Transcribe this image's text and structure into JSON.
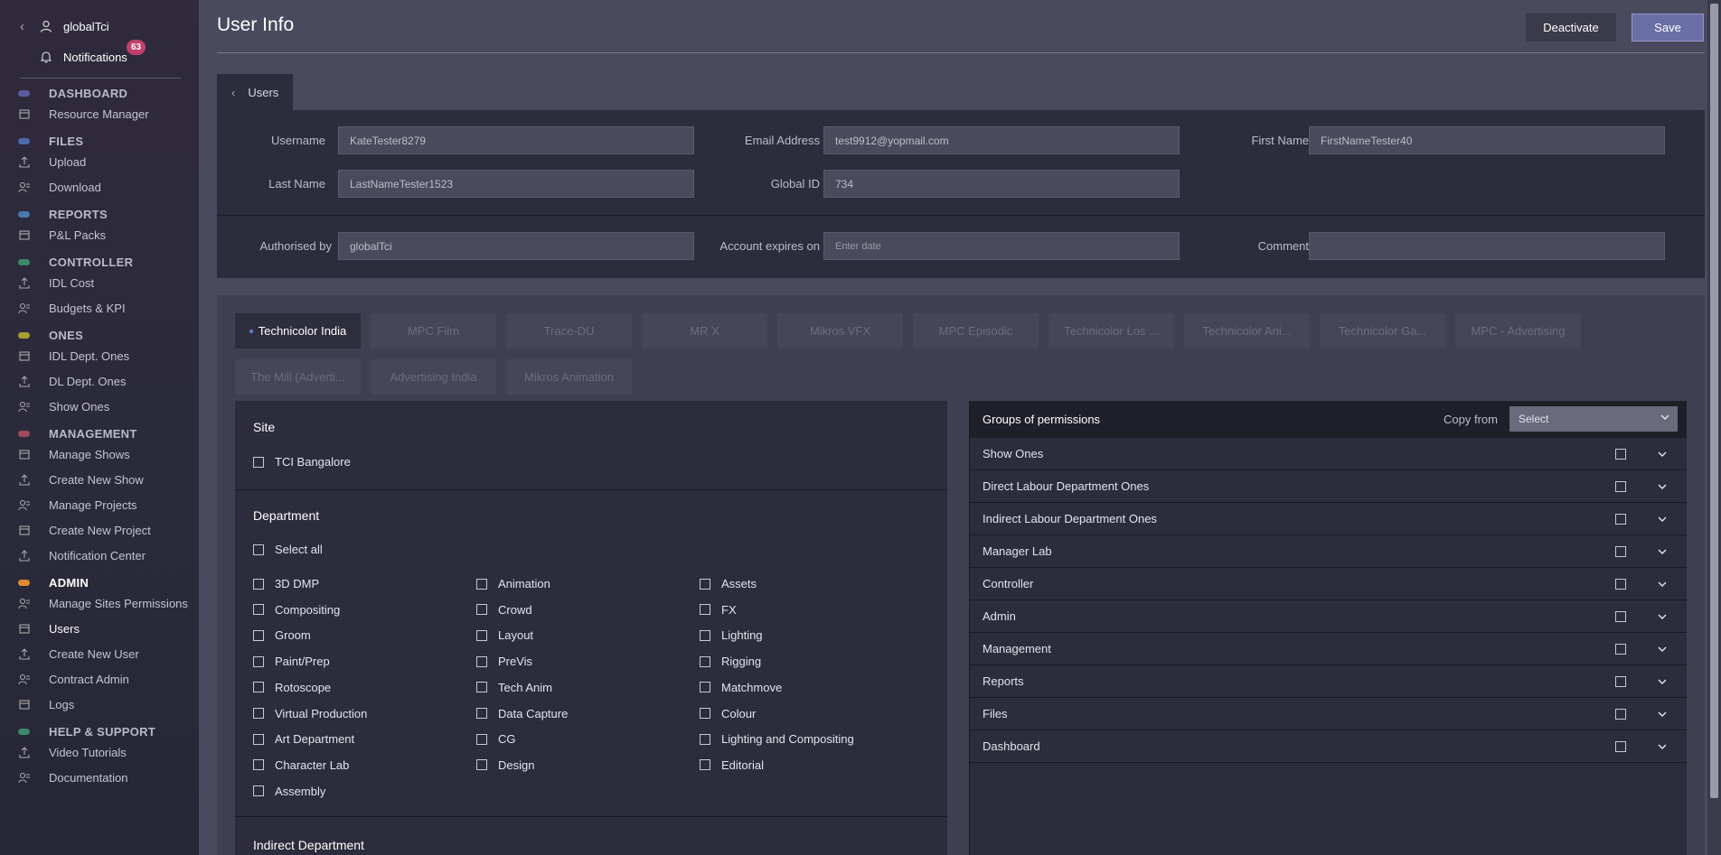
{
  "sidebar": {
    "username": "globalTci",
    "notifications_label": "Notifications",
    "notifications_count": "63",
    "sections": [
      {
        "title": "DASHBOARD",
        "color": "#5a5aa0",
        "items": [
          "Resource Manager"
        ]
      },
      {
        "title": "FILES",
        "color": "#4a6aa8",
        "items": [
          "Upload",
          "Download"
        ]
      },
      {
        "title": "REPORTS",
        "color": "#4a7ab0",
        "items": [
          "P&L Packs"
        ]
      },
      {
        "title": "CONTROLLER",
        "color": "#3a8a6a",
        "items": [
          "IDL Cost",
          "Budgets & KPI"
        ]
      },
      {
        "title": "ONES",
        "color": "#a8a030",
        "items": [
          "IDL Dept. Ones",
          "DL Dept. Ones",
          "Show Ones"
        ]
      },
      {
        "title": "MANAGEMENT",
        "color": "#a04a5a",
        "items": [
          "Manage Shows",
          "Create New Show",
          "Manage Projects",
          "Create New Project",
          "Notification Center"
        ]
      },
      {
        "title": "ADMIN",
        "color": "#e08a30",
        "items": [
          "Manage Sites Permissions",
          "Users",
          "Create New User",
          "Contract Admin",
          "Logs"
        ]
      },
      {
        "title": "HELP & SUPPORT",
        "color": "#3a8a6a",
        "items": [
          "Video Tutorials",
          "Documentation"
        ]
      }
    ]
  },
  "header": {
    "title": "User Info",
    "deactivate_label": "Deactivate",
    "save_label": "Save",
    "back_tab": "Users"
  },
  "form": {
    "username_label": "Username",
    "username_value": "KateTester8279",
    "email_label": "Email Address",
    "email_value": "test9912@yopmail.com",
    "firstname_label": "First Name",
    "firstname_value": "FirstNameTester40",
    "lastname_label": "Last Name",
    "lastname_value": "LastNameTester1523",
    "globalid_label": "Global ID",
    "globalid_value": "734",
    "authorised_label": "Authorised by",
    "authorised_value": "globalTci",
    "expires_label": "Account expires on",
    "expires_placeholder": "Enter date",
    "comment_label": "Comment",
    "comment_value": ""
  },
  "site_tabs": [
    "Technicolor India",
    "MPC Film",
    "Trace-DU",
    "MR X",
    "Mikros VFX",
    "MPC Episodic",
    "Technicolor Los ...",
    "Technicolor Ani...",
    "Technicolor Ga...",
    "MPC - Advertising",
    "The Mill (Adverti...",
    "Advertising India",
    "Mikros Animation"
  ],
  "site_section": {
    "title": "Site",
    "options": [
      "TCI Bangalore"
    ]
  },
  "department_section": {
    "title": "Department",
    "select_all": "Select all",
    "col1": [
      "3D DMP",
      "Compositing",
      "Groom",
      "Paint/Prep",
      "Rotoscope",
      "Virtual Production",
      "Art Department",
      "Character Lab",
      "Assembly"
    ],
    "col2": [
      "Animation",
      "Crowd",
      "Layout",
      "PreVis",
      "Tech Anim",
      "Data Capture",
      "CG",
      "Design"
    ],
    "col3": [
      "Assets",
      "FX",
      "Lighting",
      "Rigging",
      "Matchmove",
      "Colour",
      "Lighting and Compositing",
      "Editorial"
    ]
  },
  "indirect_section": {
    "title": "Indirect Department"
  },
  "permissions": {
    "title": "Groups of permissions",
    "copy_from_label": "Copy from",
    "select_value": "Select",
    "groups": [
      "Show Ones",
      "Direct Labour Department Ones",
      "Indirect Labour Department Ones",
      "Manager Lab",
      "Controller",
      "Admin",
      "Management",
      "Reports",
      "Files",
      "Dashboard"
    ]
  }
}
